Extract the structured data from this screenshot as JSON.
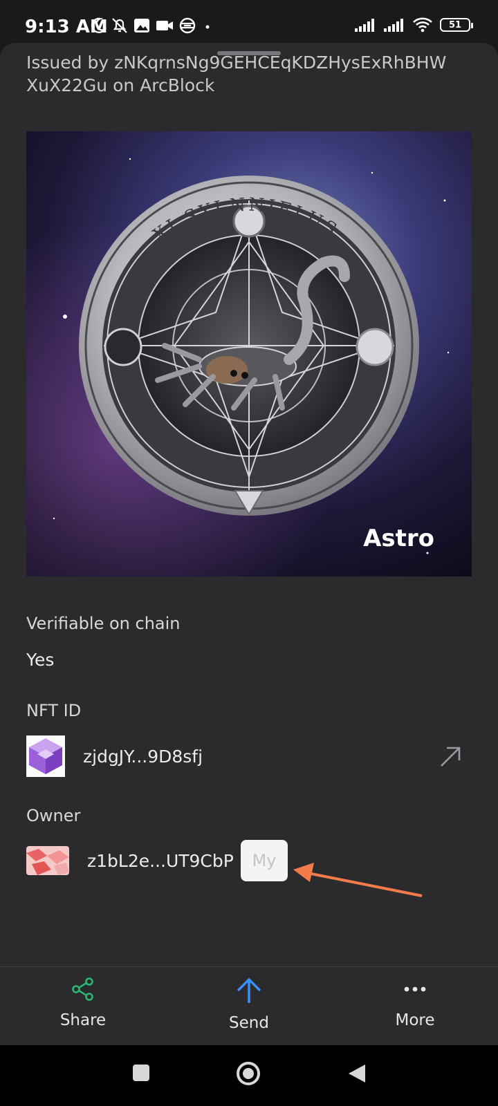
{
  "status_bar": {
    "time": "9:13 AM",
    "battery": "51",
    "left_icons": [
      "moon-icon",
      "bell-off-icon",
      "image-icon",
      "video-icon",
      "globe-icon",
      "dot-icon"
    ],
    "right_icons": [
      "signal-icon",
      "signal-icon",
      "wifi-icon",
      "battery-icon"
    ]
  },
  "header": {
    "issued_line": "Issued by zNKqrnsNg9GEHCEqKDZHysExRhBHW XuX22Gu on ArcBlock"
  },
  "nft_image": {
    "brand_text": "Astro",
    "ring_text": "XI SYLNNIELUS"
  },
  "details": {
    "verifiable_label": "Verifiable on chain",
    "verifiable_value": "Yes",
    "nft_id_label": "NFT ID",
    "nft_id_value": "zjdgJY...9D8sfj",
    "owner_label": "Owner",
    "owner_value": "z1bL2e...UT9CbP",
    "owner_badge": "My"
  },
  "actions": {
    "share": "Share",
    "send": "Send",
    "more": "More"
  },
  "colors": {
    "share_icon": "#2bb673",
    "send_icon": "#3a8ef6",
    "annotation_arrow": "#f47b4a",
    "sheet_background": "#2b2b2e"
  }
}
